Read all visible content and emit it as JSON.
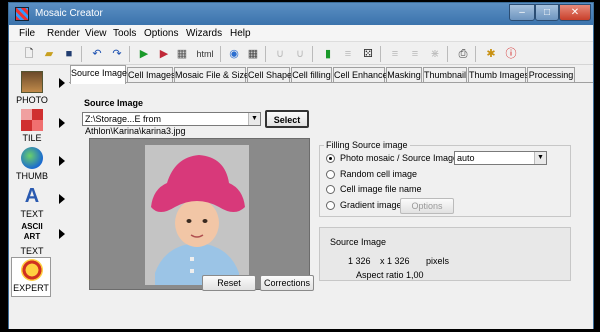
{
  "window": {
    "title": "Mosaic Creator",
    "minimize": "–",
    "maximize": "□",
    "close": "✕"
  },
  "menu": [
    "File",
    "Render",
    "View",
    "Tools",
    "Options",
    "Wizards",
    "Help"
  ],
  "toolbar": {
    "html_label": "html",
    "icons": [
      "new-icon",
      "open-icon",
      "save-icon",
      "undo-icon",
      "redo-icon",
      "play-icon",
      "record-icon",
      "html-icon",
      "globe-icon",
      "grid-icon",
      "magnet-icon",
      "magnet-disabled-icon",
      "cells-green-icon",
      "cells-disabled-icon",
      "dice-icon",
      "bars-disabled-icon",
      "bars2-disabled-icon",
      "split-disabled-icon",
      "print-icon",
      "settings-icon",
      "info-icon"
    ]
  },
  "sidebar": [
    {
      "label": "PHOTO"
    },
    {
      "label": "TILE"
    },
    {
      "label": "THUMB"
    },
    {
      "label": "TEXT"
    },
    {
      "label": "TEXT",
      "art_label": "ASCII\nART"
    },
    {
      "label": "EXPERT"
    }
  ],
  "tabs": [
    "Source Image",
    "Cell Images",
    "Mosaic File & Size",
    "Cell Shape",
    "Cell filling",
    "Cell Enhance",
    "Masking",
    "Thumbnail",
    "Thumb Images",
    "Processing"
  ],
  "source": {
    "heading": "Source Image",
    "path": "Z:\\Storage...E from Athlon\\Karina\\karina3.jpg",
    "select_label": "Select",
    "reset_label": "Reset",
    "corrections_label": "Corrections"
  },
  "filling": {
    "legend": "Filling Source image",
    "options": [
      "Photo mosaic / Source Image",
      "Random cell image",
      "Cell image file name",
      "Gradient image"
    ],
    "selected_index": 0,
    "mode_value": "auto",
    "options_button": "Options"
  },
  "info": {
    "heading": "Source Image",
    "width": "1 326",
    "times": "x 1 326",
    "unit": "pixels",
    "aspect": "Aspect ratio 1,00"
  },
  "colors": {
    "titlebar": "#4a82bb",
    "hat": "#d8397a",
    "coat": "#9bc4e6",
    "accent_green": "#1a9a2a"
  }
}
